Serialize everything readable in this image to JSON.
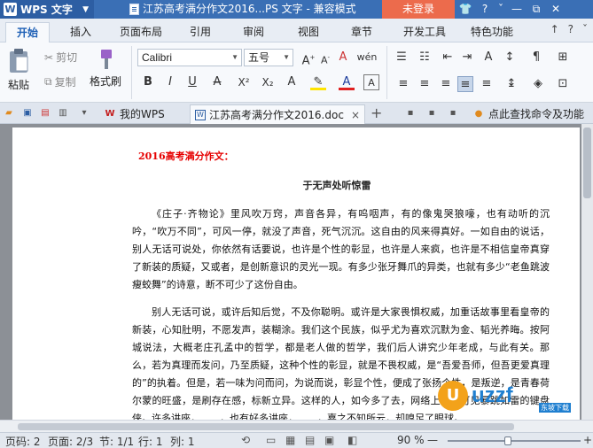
{
  "titlebar": {
    "app_name": "WPS 文字",
    "doc_title": "江苏高考满分作文2016...PS 文字 - 兼容模式",
    "login_label": "未登录",
    "icons": [
      "skin-icon",
      "help-icon",
      "restore-icon",
      "close-icon"
    ],
    "icon_glyphs": [
      "👕",
      "?",
      "⧉",
      "✕"
    ]
  },
  "menu": {
    "tabs": [
      "开始",
      "插入",
      "页面布局",
      "引用",
      "审阅",
      "视图",
      "章节",
      "开发工具",
      "特色功能"
    ],
    "active": "开始",
    "right_glyphs": [
      "↑",
      "?",
      "ˇ"
    ]
  },
  "ribbon": {
    "paste_label": "粘贴",
    "cut_label": "剪切",
    "copy_label": "复制",
    "format_painter_label": "格式刷",
    "font_name": "Calibri",
    "font_size": "五号",
    "fmt_buttons": [
      "B",
      "I",
      "U",
      "A",
      "X²",
      "X₂",
      "A"
    ],
    "font_glyphs": [
      "A+",
      "A-",
      "A",
      "wén"
    ]
  },
  "tabsrow": {
    "mywps_label": "我的WPS",
    "doc_tab_label": "江苏高考满分作文2016.doc",
    "close_glyph": "×",
    "add_glyph": "+",
    "search_label": "点此查找命令及功能"
  },
  "document": {
    "heading": "2016高考满分作文：",
    "subtitle": "于无声处听惊雷",
    "paragraphs": [
      "《庄子·齐物论》里风吹万窍，声音各异，有呜咽声，有的像鬼哭狼嚎，也有动听的沉吟，“吹万不同”，可风一停，就没了声音，死气沉沉。这自由的风来得真好。一如自由的说话，别人无话可说处，你依然有话要说，也许是个性的彰显，也许是人来疯，也许是不相信皇帝真穿了新装的质疑，又或者，是创新意识的灵光一现。有多少张牙舞爪的异类，也就有多少“老鱼跳波瘦蛟舞”的诗意，断不可少了这份自由。",
      "别人无话可说，或许后知后觉，不及你聪明。或许是大家畏惧权威，加重话故事里看皇帝的新装，心知肚明，不愿发声，装糊涂。我们这个民族，似乎尤为喜欢沉默为金、韬光养晦。按阿城说法，大概老庄孔孟中的哲学，都是老人做的哲学，我们后人讲究少年老成，与此有关。那么，若为真理而发问，乃至质疑，这种个性的彰显，就是不畏权威，是“吾爱吾师，但吾更爱真理的”的执着。但是，若一味为问而问，为说而说，彰显个性，便成了张扬个性，是叛逆，是青春荷尔蒙的旺盛，是刷存在感，标新立异。这样的人，如今多了去，网络上随处可见暴跳如雷的键盘侠。许多讲座，……，也有好多讲座，……，嘉之不知所云，却嗅足了眼球。"
    ]
  },
  "watermark": {
    "logo_text": "U",
    "brand": "uzzf",
    "sub": "东坡下载"
  },
  "statusbar": {
    "page_code": "页码: 2",
    "page": "页面: 2/3",
    "section": "节: 1/1",
    "row": "行: 1",
    "col": "列: 1",
    "zoom": "90 %",
    "zoom_minus": "—",
    "zoom_plus": "+",
    "zoom_value": 0.45
  }
}
